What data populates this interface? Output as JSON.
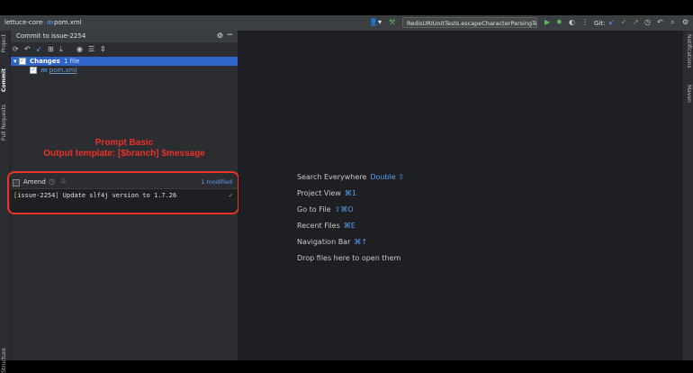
{
  "breadcrumb": {
    "project": "lettuce-core",
    "file": "pom.xml",
    "file_icon": "m"
  },
  "toolbar": {
    "run_config": "RedisURIUnitTests.escapeCharacterParsingTest",
    "git_label": "Git:"
  },
  "left_tabs": [
    "Project",
    "Commit",
    "Pull Requests",
    "Structure"
  ],
  "right_tabs": [
    "Notifications",
    "Maven"
  ],
  "commit_panel": {
    "title": "Commit to issue-2254",
    "changes_label": "Changes",
    "changes_count": "1 file",
    "file_name": "pom.xml",
    "amend_label": "Amend",
    "modified": "1 modified",
    "message_branch": "issue-2254",
    "message_text": " Update slf4j version to 1.7.26"
  },
  "annotation": {
    "line1": "Prompt Basic",
    "line2": "Output template: [$branch] $message"
  },
  "editor_hints": [
    {
      "label": "Search Everywhere",
      "key": "Double ⇧"
    },
    {
      "label": "Project View",
      "key": "⌘1"
    },
    {
      "label": "Go to File",
      "key": "⇧⌘O"
    },
    {
      "label": "Recent Files",
      "key": "⌘E"
    },
    {
      "label": "Navigation Bar",
      "key": "⌘↑"
    },
    {
      "label": "Drop files here to open them",
      "key": ""
    }
  ]
}
